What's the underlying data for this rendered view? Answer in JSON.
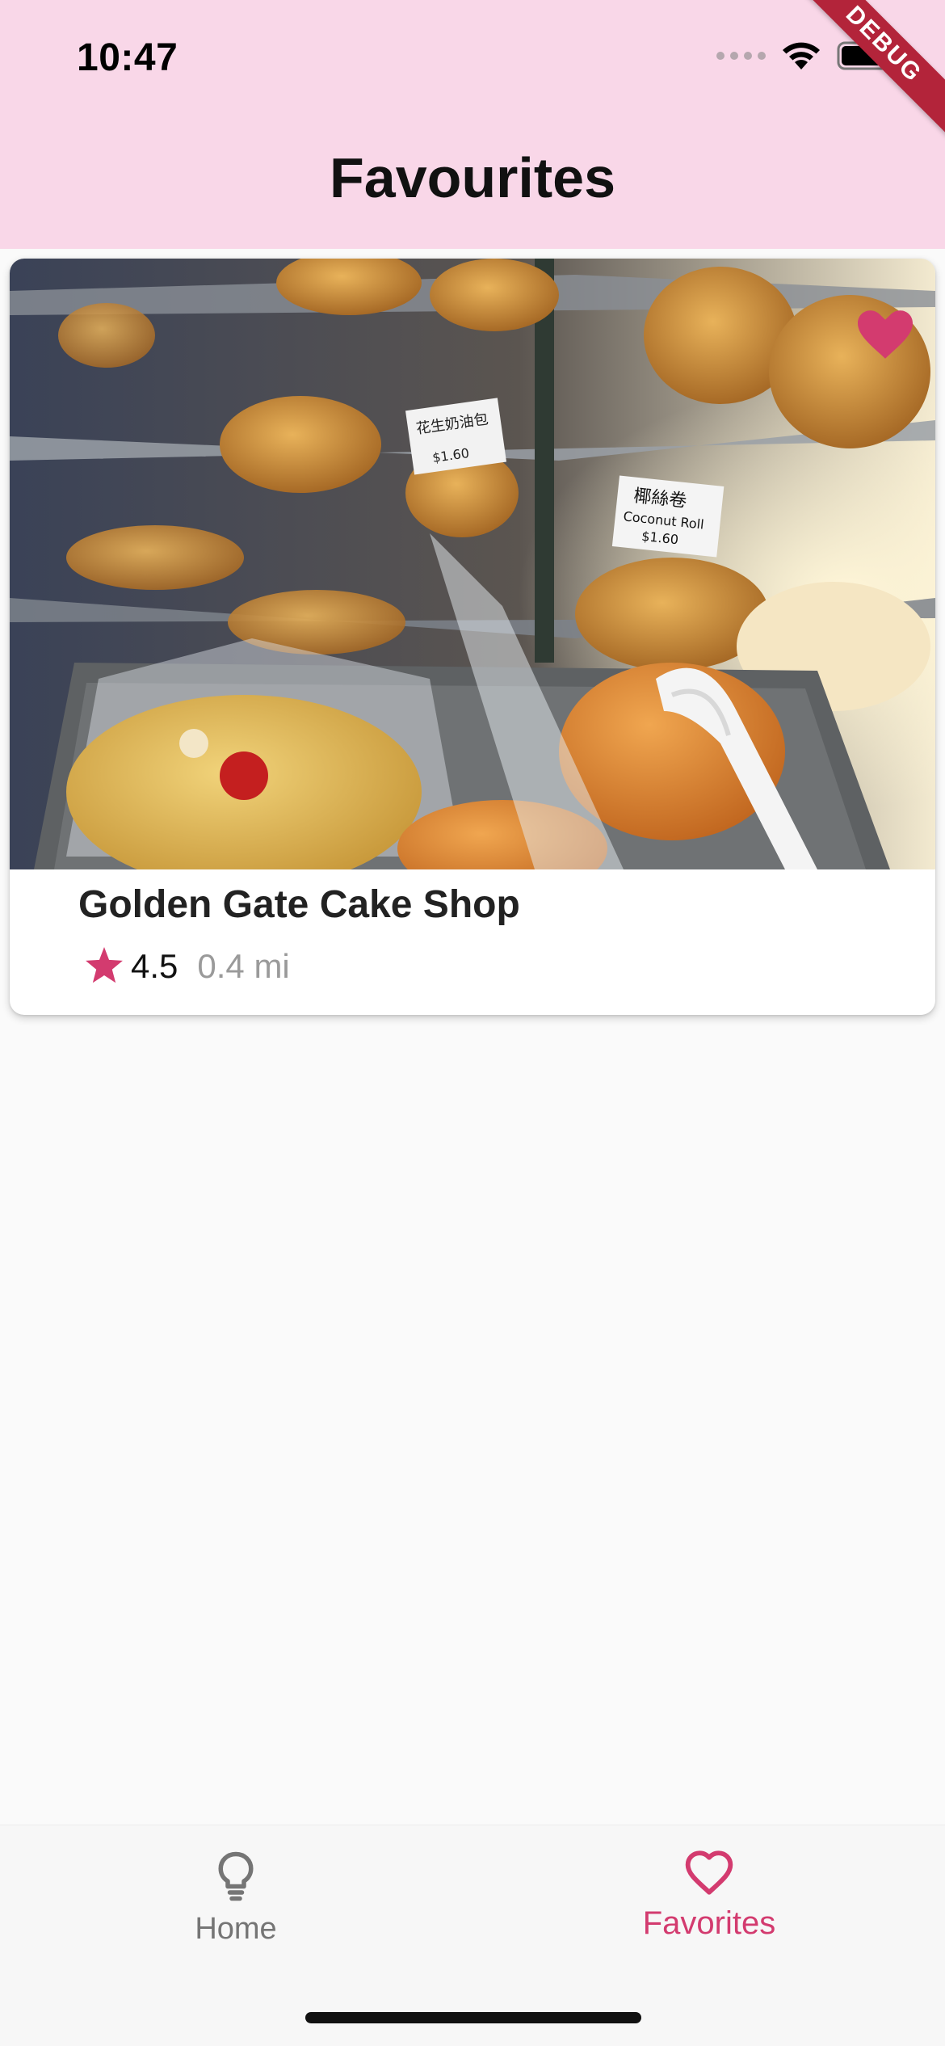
{
  "status_bar": {
    "time": "10:47",
    "icons": [
      "cellular-signal-icon",
      "wifi-icon",
      "battery-icon"
    ]
  },
  "debug_banner": {
    "label": "DEBUG",
    "color": "#b3243a"
  },
  "app_bar": {
    "title": "Favourites",
    "background": "#f9d7e8"
  },
  "favorites": [
    {
      "name": "Golden Gate Cake Shop",
      "rating": "4.5",
      "distance": "0.4 mi",
      "is_favorite": true,
      "photo_signs": [
        "花生奶油包",
        "$1.60",
        "椰絲卷",
        "Coconut Roll",
        "$1.60"
      ]
    }
  ],
  "bottom_nav": {
    "items": [
      {
        "label": "Home",
        "icon": "lightbulb-outline-icon",
        "selected": false
      },
      {
        "label": "Favorites",
        "icon": "heart-outline-icon",
        "selected": true
      }
    ]
  },
  "colors": {
    "accent": "#d33b6f",
    "inactive": "#757575",
    "muted_text": "#9a9a9a",
    "page_background": "#fafafa"
  }
}
